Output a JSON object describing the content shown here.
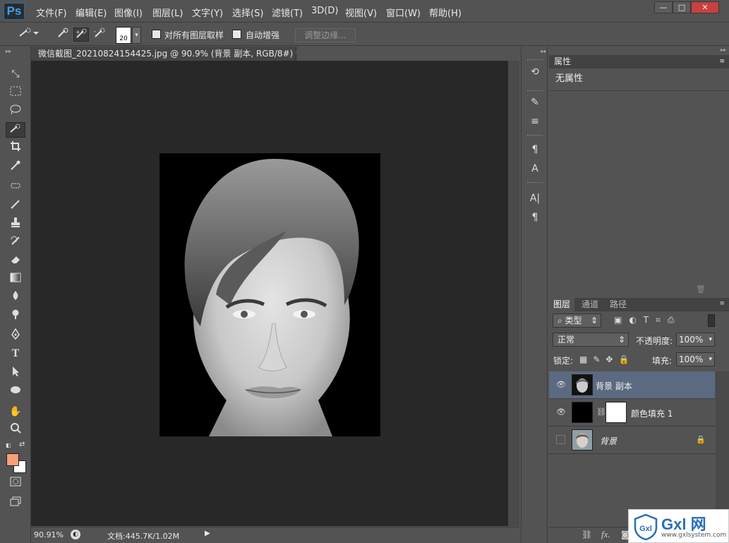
{
  "app": {
    "logo": "Ps"
  },
  "menu": [
    "文件(F)",
    "编辑(E)",
    "图像(I)",
    "图层(L)",
    "文字(Y)",
    "选择(S)",
    "滤镜(T)",
    "3D(D)",
    "视图(V)",
    "窗口(W)",
    "帮助(H)"
  ],
  "window_controls": {
    "minimize": "—",
    "restore": "□",
    "close": "✕"
  },
  "options": {
    "brush_size": "20",
    "sample_all_layers": "对所有图层取样",
    "auto_enhance": "自动增强",
    "refine_edge": "调整边缘..."
  },
  "document": {
    "tab_title": "微信截图_20210824154425.jpg @ 90.9% (背景 副本, RGB/8#) *",
    "close": "×"
  },
  "status": {
    "zoom": "90.91%",
    "doc_size": "文档:445.7K/1.02M"
  },
  "colors": {
    "foreground": "#f7a07a",
    "background": "#ffffff"
  },
  "properties": {
    "tab": "属性",
    "content": "无属性"
  },
  "layers_panel": {
    "tabs": [
      "图层",
      "通道",
      "路径"
    ],
    "filter_kind": "类型",
    "blend_mode": "正常",
    "opacity_label": "不透明度:",
    "opacity": "100%",
    "lock_label": "锁定:",
    "fill_label": "填充:",
    "fill": "100%",
    "layers": [
      {
        "name": "背景 副本",
        "visible": true,
        "selected": true
      },
      {
        "name": "颜色填充 1",
        "visible": true,
        "selected": false
      },
      {
        "name": "背景",
        "visible": false,
        "selected": false,
        "locked": true
      }
    ]
  },
  "watermark": {
    "brand": "Gxl 网",
    "url": "www.gxlsystem.com"
  }
}
